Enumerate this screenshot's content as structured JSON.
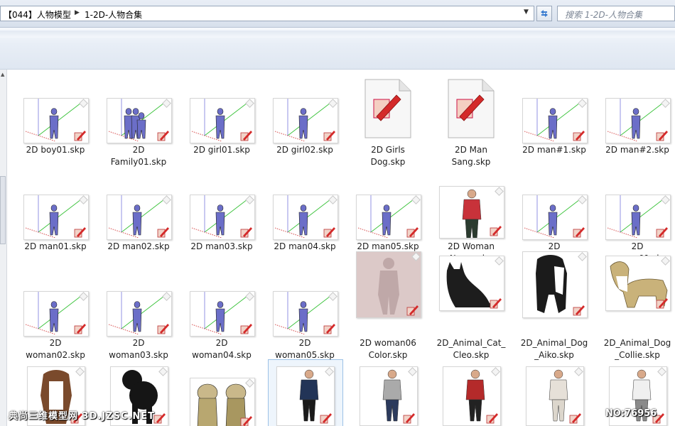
{
  "address_bar": {
    "crumbs": [
      "【044】人物模型",
      "1-2D-人物合集"
    ],
    "search_placeholder": "搜索 1-2D-人物合集"
  },
  "icons": {
    "sketchup_badge": "sketchup-pencil-icon",
    "refresh": "refresh-icon",
    "dropdown": "chevron-down-icon",
    "breadcrumb_separator": "chevron-right-icon"
  },
  "colors": {
    "figure_purple": "#6b6ec8",
    "axis_green": "#38c238",
    "axis_red": "#d23a3a",
    "selection": "#9cc1e6"
  },
  "files": [
    {
      "name": "2D boy01.skp",
      "lines": [
        "2D boy01.skp"
      ],
      "kind": "purple"
    },
    {
      "name": "2D Family01.skp",
      "lines": [
        "2D",
        "Family01.skp"
      ],
      "kind": "purple"
    },
    {
      "name": "2D girl01.skp",
      "lines": [
        "2D girl01.skp"
      ],
      "kind": "purple"
    },
    {
      "name": "2D girl02.skp",
      "lines": [
        "2D girl02.skp"
      ],
      "kind": "purple"
    },
    {
      "name": "2D Girls Dog.skp",
      "lines": [
        "2D Girls",
        "Dog.skp"
      ],
      "kind": "doc"
    },
    {
      "name": "2D Man Sang.skp",
      "lines": [
        "2D Man",
        "Sang.skp"
      ],
      "kind": "doc"
    },
    {
      "name": "2D man#1.skp",
      "lines": [
        "2D man#1.skp"
      ],
      "kind": "purple"
    },
    {
      "name": "2D man#2.skp",
      "lines": [
        "2D man#2.skp"
      ],
      "kind": "purple"
    },
    {
      "name": "2D man01.skp",
      "lines": [
        "2D man01.skp"
      ],
      "kind": "purple"
    },
    {
      "name": "2D man02.skp",
      "lines": [
        "2D man02.skp"
      ],
      "kind": "purple"
    },
    {
      "name": "2D man03.skp",
      "lines": [
        "2D man03.skp"
      ],
      "kind": "purple"
    },
    {
      "name": "2D man04.skp",
      "lines": [
        "2D man04.skp"
      ],
      "kind": "purple"
    },
    {
      "name": "2D man05.skp",
      "lines": [
        "2D man05.skp"
      ],
      "kind": "purple"
    },
    {
      "name": "2D Woman Nancy.skp",
      "lines": [
        "2D Woman",
        "Nancy.skp"
      ],
      "kind": "photo"
    },
    {
      "name": "2D woman#1.skp",
      "lines": [
        "2D",
        "woman#1.skp"
      ],
      "kind": "purple"
    },
    {
      "name": "2D woman01.skp",
      "lines": [
        "2D",
        "woman01.skp"
      ],
      "kind": "purple"
    },
    {
      "name": "2D woman02.skp",
      "lines": [
        "2D",
        "woman02.skp"
      ],
      "kind": "purple"
    },
    {
      "name": "2D woman03.skp",
      "lines": [
        "2D",
        "woman03.skp"
      ],
      "kind": "purple"
    },
    {
      "name": "2D woman04.skp",
      "lines": [
        "2D",
        "woman04.skp"
      ],
      "kind": "purple"
    },
    {
      "name": "2D woman05.skp",
      "lines": [
        "2D",
        "woman05.skp"
      ],
      "kind": "purple"
    },
    {
      "name": "2D woman06 Color.skp",
      "lines": [
        "2D woman06",
        "Color.skp"
      ],
      "kind": "ghost"
    },
    {
      "name": "2D_Animal_Cat_Cleo.skp",
      "lines": [
        "2D_Animal_Cat_",
        "Cleo.skp"
      ],
      "kind": "cat"
    },
    {
      "name": "2D_Animal_Dog_Aiko.skp",
      "lines": [
        "2D_Animal_Dog",
        "_Aiko.skp"
      ],
      "kind": "dog-bw"
    },
    {
      "name": "2D_Animal_Dog_Collie.skp",
      "lines": [
        "2D_Animal_Dog",
        "_Collie.skp"
      ],
      "kind": "dog-collie"
    },
    {
      "name": "",
      "lines": [],
      "kind": "dog-basset"
    },
    {
      "name": "",
      "lines": [],
      "kind": "dog-poodle"
    },
    {
      "name": "",
      "lines": [],
      "kind": "dog-pugs"
    },
    {
      "name": "",
      "lines": [],
      "kind": "person-jacket"
    },
    {
      "name": "",
      "lines": [],
      "kind": "person-grey"
    },
    {
      "name": "",
      "lines": [],
      "kind": "person-red"
    },
    {
      "name": "",
      "lines": [],
      "kind": "person-light"
    },
    {
      "name": "",
      "lines": [],
      "kind": "person-light2"
    }
  ],
  "watermark": {
    "left": "典尚三维模型网 3D.JZSC.NET",
    "right": "NO:76956"
  }
}
